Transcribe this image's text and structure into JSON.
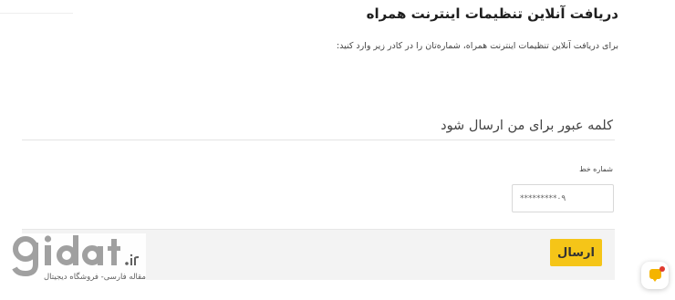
{
  "page": {
    "title": "دریافت آنلاین تنظیمات اینترنت همراه",
    "subtitle": "برای دریافت آنلاین تنظیمات اینترنت همراه، شماره‌تان را در کادر زیر وارد کنید:"
  },
  "form": {
    "section_title": "کلمه عبور برای من ارسال شود",
    "phone_label": "شماره خط",
    "phone_placeholder": "*********۰۹",
    "submit_label": "ارسال"
  },
  "watermark": {
    "brand": "gidat",
    "domain_suffix": ".ir",
    "tagline": "مقاله فارسی- فروشگاه دیجیتال"
  },
  "chat_widget": {
    "icon": "chat-bubble-icon",
    "accent_color": "#f5b400",
    "notification_color": "#e03a2f"
  },
  "colors": {
    "button": "#f5c518",
    "submit_bar": "#f3f3f3"
  }
}
